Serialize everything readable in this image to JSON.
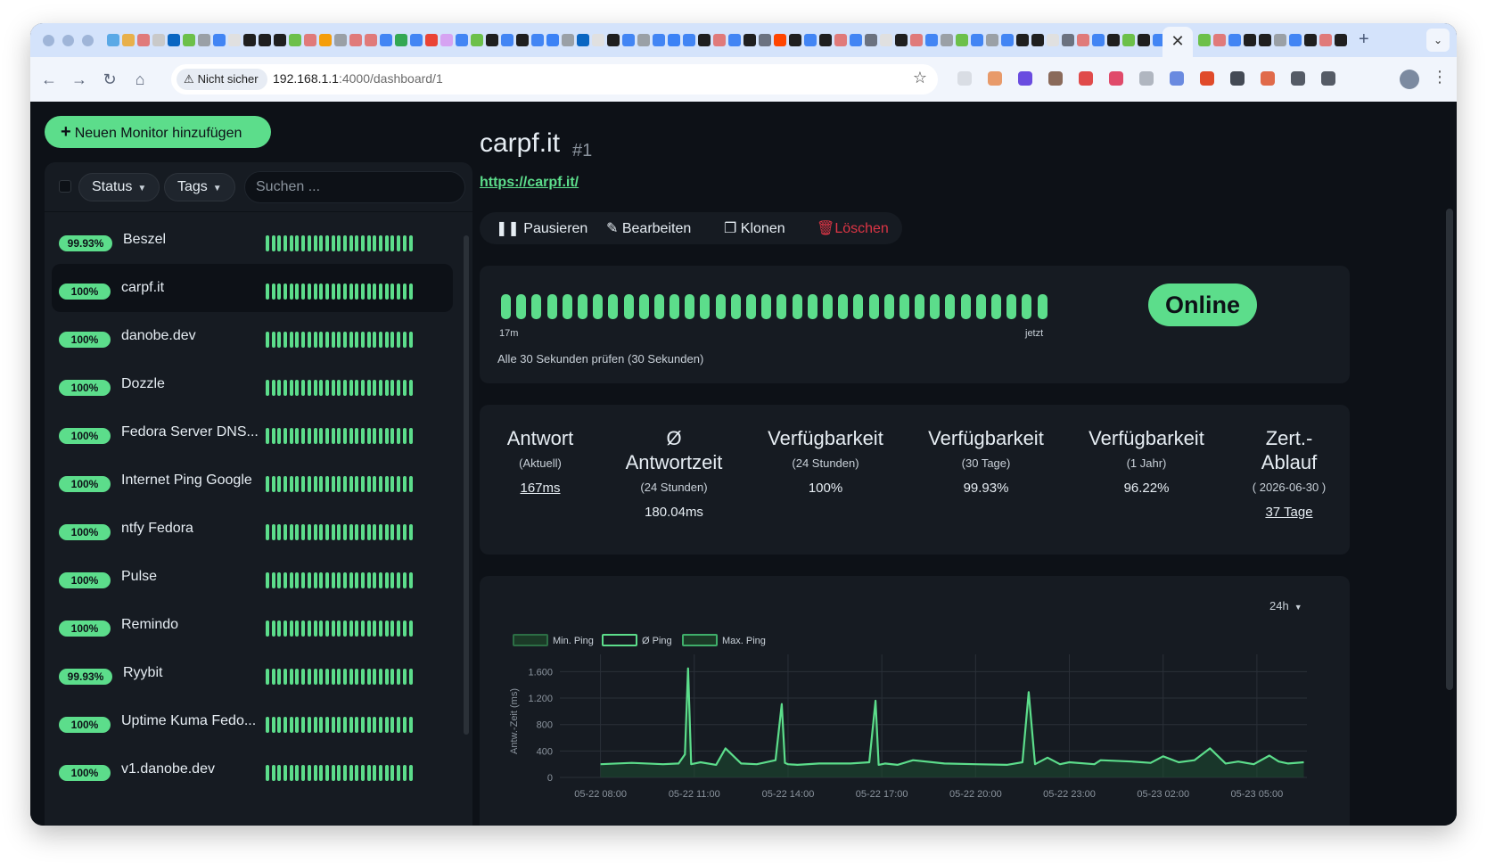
{
  "browser": {
    "tab_colors": [
      "#5aa9e6",
      "#e8b04b",
      "#e07a7a",
      "#c9c9c9",
      "#0a66c2",
      "#6cc04a",
      "#9aa0a6",
      "#4285f4",
      "#e0e0e0",
      "#1f1f1f",
      "#1f1f1f",
      "#1f1f1f",
      "#6cc04a",
      "#e07a7a",
      "#f59e0b",
      "#9aa0a6",
      "#e07a7a",
      "#e07a7a",
      "#4285f4",
      "#34a853",
      "#4285f4",
      "#ea4335",
      "#d6a3f2",
      "#4285f4",
      "#6cc04a",
      "#1f1f1f",
      "#4285f4",
      "#1f1f1f",
      "#4285f4",
      "#3b82f6",
      "#9aa0a6",
      "#0a66c2",
      "#e0e0e0",
      "#1f1f1f",
      "#4285f4",
      "#9aa0a6",
      "#4285f4",
      "#3b82f6",
      "#4285f4",
      "#1f1f1f",
      "#e07a7a",
      "#4285f4",
      "#1f1f1f",
      "#6b7280",
      "#ff4500",
      "#1f1f1f",
      "#4285f4",
      "#1f1f1f",
      "#e07a7a",
      "#4285f4",
      "#6b7280",
      "#e0e0e0",
      "#1f1f1f",
      "#e07a7a",
      "#4285f4",
      "#9aa0a6",
      "#6cc04a",
      "#4285f4",
      "#9aa0a6",
      "#4285f4",
      "#1f1f1f",
      "#1f1f1f",
      "#e0e0e0",
      "#6b7280",
      "#e07a7a",
      "#4285f4",
      "#1f1f1f",
      "#6cc04a",
      "#1f1f1f",
      "#4285f4",
      "#9aa0a6"
    ],
    "tab_colors_right": [
      "#6cc04a",
      "#e07a7a",
      "#4285f4",
      "#1f1f1f",
      "#1f1f1f",
      "#9aa0a6",
      "#4285f4",
      "#1f1f1f",
      "#e07a7a",
      "#1f1f1f"
    ],
    "active_tab_close": "✕",
    "new_tab": "+",
    "tab_menu": "⌄",
    "security_label": "Nicht sicher",
    "url_host": "192.168.1.1",
    "url_path": ":4000/dashboard/1",
    "ext_colors": [
      "#d9dde4",
      "#e89a6a",
      "#6a4ce0",
      "#8a6a5a",
      "#e04a4a",
      "#e04a6a",
      "#b0b6c0",
      "#6a8ae0",
      "#e04a2a",
      "#444a55",
      "#e06a4a",
      "#555b66",
      "#555b66"
    ]
  },
  "sidebar": {
    "add_button": "Neuen Monitor hinzufügen",
    "filter_status": "Status",
    "filter_tags": "Tags",
    "search_placeholder": "Suchen ...",
    "monitors": [
      {
        "uptime": "99.93%",
        "name": "Beszel",
        "selected": false
      },
      {
        "uptime": "100%",
        "name": "carpf.it",
        "selected": true
      },
      {
        "uptime": "100%",
        "name": "danobe.dev",
        "selected": false
      },
      {
        "uptime": "100%",
        "name": "Dozzle",
        "selected": false
      },
      {
        "uptime": "100%",
        "name": "Fedora Server DNS...",
        "selected": false
      },
      {
        "uptime": "100%",
        "name": "Internet Ping Google",
        "selected": false
      },
      {
        "uptime": "100%",
        "name": "ntfy Fedora",
        "selected": false
      },
      {
        "uptime": "100%",
        "name": "Pulse",
        "selected": false
      },
      {
        "uptime": "100%",
        "name": "Remindo",
        "selected": false
      },
      {
        "uptime": "99.93%",
        "name": "Ryybit",
        "selected": false
      },
      {
        "uptime": "100%",
        "name": "Uptime Kuma Fedo...",
        "selected": false
      },
      {
        "uptime": "100%",
        "name": "v1.danobe.dev",
        "selected": false
      }
    ],
    "heartbeats_per_row": 25
  },
  "detail": {
    "title": "carpf.it",
    "id": "#1",
    "url": "https://carpf.it/",
    "actions": {
      "pause": "Pausieren",
      "edit": "Bearbeiten",
      "clone": "Klonen",
      "delete": "Löschen"
    },
    "heartbeat_count": 36,
    "beat_start": "17m",
    "beat_end": "jetzt",
    "interval_text": "Alle 30 Sekunden prüfen (30 Sekunden)",
    "status": "Online",
    "stats": [
      {
        "heading": "Antwort",
        "sub": "(Aktuell)",
        "value": "167ms",
        "underline": true
      },
      {
        "heading": "Ø Antwortzeit",
        "sub": "(24 Stunden)",
        "value": "180.04ms",
        "underline": false
      },
      {
        "heading": "Verfügbarkeit",
        "sub": "(24 Stunden)",
        "value": "100%",
        "underline": false
      },
      {
        "heading": "Verfügbarkeit",
        "sub": "(30 Tage)",
        "value": "99.93%",
        "underline": false
      },
      {
        "heading": "Verfügbarkeit",
        "sub": "(1 Jahr)",
        "value": "96.22%",
        "underline": false
      },
      {
        "heading": "Zert.-Ablauf",
        "sub": "( 2026-06-30 )",
        "value": "37 Tage",
        "underline": true
      }
    ],
    "range": "24h"
  },
  "chart_data": {
    "type": "line",
    "legend": [
      "Min. Ping",
      "Ø Ping",
      "Max. Ping"
    ],
    "ylabel": "Antw.-Zeit (ms)",
    "ylim": [
      0,
      1700
    ],
    "yticks": [
      0,
      400,
      800,
      1200,
      1600
    ],
    "ytick_labels": [
      "0",
      "400",
      "800",
      "1.200",
      "1.600"
    ],
    "xlim_hours": [
      6.7,
      30.6
    ],
    "xticks_hours": [
      8,
      11,
      14,
      17,
      20,
      23,
      26,
      29
    ],
    "xtick_labels": [
      "05-22 08:00",
      "05-22 11:00",
      "05-22 14:00",
      "05-22 17:00",
      "05-22 20:00",
      "05-22 23:00",
      "05-23 02:00",
      "05-23 05:00"
    ],
    "x_hours": [
      8.0,
      9.0,
      10.0,
      10.5,
      10.7,
      10.8,
      10.9,
      11.2,
      11.7,
      12.0,
      12.5,
      13.0,
      13.6,
      13.8,
      13.9,
      14.0,
      14.3,
      15.0,
      16.0,
      16.6,
      16.8,
      16.9,
      17.1,
      17.5,
      18.0,
      19.0,
      20.0,
      21.0,
      21.5,
      21.7,
      21.9,
      22.3,
      22.7,
      23.0,
      23.8,
      24.0,
      25.0,
      25.6,
      26.0,
      26.5,
      27.0,
      27.5,
      28.0,
      28.4,
      28.9,
      29.4,
      29.7,
      30.0,
      30.5
    ],
    "series": [
      {
        "name": "Ø Ping",
        "values": [
          200,
          220,
          200,
          210,
          350,
          1650,
          200,
          230,
          190,
          440,
          210,
          200,
          260,
          1110,
          220,
          200,
          190,
          210,
          210,
          230,
          1160,
          190,
          210,
          190,
          260,
          210,
          200,
          190,
          230,
          1290,
          200,
          300,
          200,
          230,
          200,
          260,
          240,
          220,
          320,
          230,
          260,
          440,
          210,
          240,
          200,
          330,
          240,
          210,
          230
        ]
      }
    ]
  },
  "colors": {
    "accent": "#5cdd8b",
    "danger": "#dc3545",
    "bg": "#0d1117",
    "card": "#161b22"
  }
}
